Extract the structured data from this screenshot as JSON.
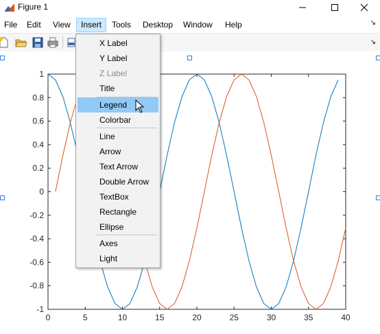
{
  "window": {
    "title": "Figure 1",
    "icon": "matlab-figure-icon",
    "controls": [
      "minimize-icon",
      "maximize-icon",
      "close-icon"
    ]
  },
  "menubar": {
    "items": [
      {
        "label": "File"
      },
      {
        "label": "Edit"
      },
      {
        "label": "View"
      },
      {
        "label": "Insert",
        "open": true
      },
      {
        "label": "Tools"
      },
      {
        "label": "Desktop"
      },
      {
        "label": "Window"
      },
      {
        "label": "Help"
      }
    ],
    "overflow_icon": "chevron-overflow-icon"
  },
  "toolbar": {
    "buttons": [
      "new-figure-icon",
      "open-file-icon",
      "save-icon",
      "print-icon",
      "print-preview-icon"
    ],
    "overflow_icon": "chevron-overflow-icon"
  },
  "insert_menu": {
    "groups": [
      [
        {
          "label": "X Label",
          "enabled": true
        },
        {
          "label": "Y Label",
          "enabled": true
        },
        {
          "label": "Z Label",
          "enabled": false
        },
        {
          "label": "Title",
          "enabled": true
        }
      ],
      [
        {
          "label": "Legend",
          "enabled": true,
          "highlighted": true
        },
        {
          "label": "Colorbar",
          "enabled": true
        }
      ],
      [
        {
          "label": "Line",
          "enabled": true
        },
        {
          "label": "Arrow",
          "enabled": true
        },
        {
          "label": "Text Arrow",
          "enabled": true
        },
        {
          "label": "Double Arrow",
          "enabled": true
        },
        {
          "label": "TextBox",
          "enabled": true
        },
        {
          "label": "Rectangle",
          "enabled": true
        },
        {
          "label": "Ellipse",
          "enabled": true
        }
      ],
      [
        {
          "label": "Axes",
          "enabled": true
        },
        {
          "label": "Light",
          "enabled": true
        }
      ]
    ]
  },
  "chart_data": {
    "type": "line",
    "title": "",
    "xlabel": "",
    "ylabel": "",
    "xlim": [
      0,
      40
    ],
    "ylim": [
      -1,
      1
    ],
    "xticks": [
      0,
      5,
      10,
      15,
      20,
      25,
      30,
      35,
      40
    ],
    "yticks": [
      -1,
      -0.8,
      -0.6,
      -0.4,
      -0.2,
      0,
      0.2,
      0.4,
      0.6,
      0.8,
      1
    ],
    "grid": false,
    "series": [
      {
        "color": "#0072BD",
        "x": [
          0,
          1,
          2,
          3,
          4,
          5,
          6,
          7,
          8,
          9,
          10,
          11,
          12,
          13,
          14,
          15,
          16,
          17,
          18,
          19,
          20,
          21,
          22,
          23,
          24,
          25,
          26,
          27,
          28,
          29,
          30,
          31,
          32,
          33,
          34,
          35,
          36,
          37,
          38,
          39
        ],
        "y": [
          1,
          0.951,
          0.809,
          0.588,
          0.309,
          0,
          -0.309,
          -0.588,
          -0.809,
          -0.951,
          -1,
          -0.951,
          -0.809,
          -0.588,
          -0.309,
          0,
          0.309,
          0.588,
          0.809,
          0.951,
          1,
          0.951,
          0.809,
          0.588,
          0.309,
          0,
          -0.309,
          -0.588,
          -0.809,
          -0.951,
          -1,
          -0.951,
          -0.809,
          -0.588,
          -0.309,
          0,
          0.309,
          0.588,
          0.809,
          0.951
        ]
      },
      {
        "color": "#D95319",
        "x": [
          1,
          2,
          3,
          4,
          5,
          6,
          7,
          8,
          9,
          10,
          11,
          12,
          13,
          14,
          15,
          16,
          17,
          18,
          19,
          20,
          21,
          22,
          23,
          24,
          25,
          26,
          27,
          28,
          29,
          30,
          31,
          32,
          33,
          34,
          35,
          36,
          37,
          38,
          39,
          40
        ],
        "y": [
          0,
          0.309,
          0.588,
          0.809,
          0.951,
          1,
          0.951,
          0.809,
          0.588,
          0.309,
          0,
          -0.309,
          -0.588,
          -0.809,
          -0.951,
          -1,
          -0.951,
          -0.809,
          -0.588,
          -0.309,
          0,
          0.309,
          0.588,
          0.809,
          0.951,
          1,
          0.951,
          0.809,
          0.588,
          0.309,
          0,
          -0.309,
          -0.588,
          -0.809,
          -0.951,
          -1,
          -0.951,
          -0.809,
          -0.588,
          -0.309
        ]
      }
    ]
  }
}
